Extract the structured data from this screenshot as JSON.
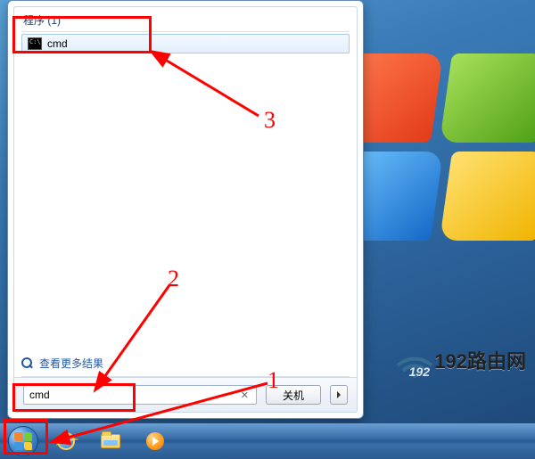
{
  "start_menu": {
    "section_header": "程序 (1)",
    "result": {
      "label": "cmd"
    },
    "more_results": "查看更多结果",
    "search_value": "cmd",
    "shutdown_label": "关机"
  },
  "annotations": {
    "label1": "1",
    "label2": "2",
    "label3": "3"
  },
  "watermark": {
    "text": "192路由网",
    "badge": "192"
  }
}
